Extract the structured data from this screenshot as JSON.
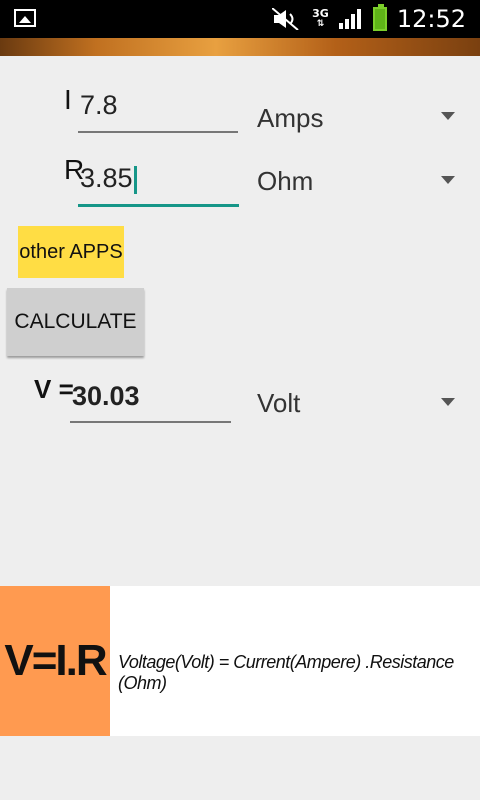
{
  "status_bar": {
    "network": "3G",
    "time": "12:52"
  },
  "form": {
    "current": {
      "label": "I",
      "value": "7.8",
      "unit": "Amps"
    },
    "resistance": {
      "label": "R",
      "value": "3.85",
      "unit": "Ohm"
    },
    "voltage": {
      "label": "V =",
      "value": "30.03",
      "unit": "Volt"
    }
  },
  "buttons": {
    "other_apps": "other APPS",
    "calculate": "CALCULATE"
  },
  "formula_banner": {
    "formula": "V=I.R",
    "description": "Voltage(Volt) = Current(Ampere) .Resistance (Ohm)",
    "accent_color": "#ff9a50"
  },
  "icons": [
    "gallery-icon",
    "mute-icon",
    "data-arrows-icon",
    "signal-icon",
    "battery-icon",
    "dropdown-arrow-icon"
  ]
}
